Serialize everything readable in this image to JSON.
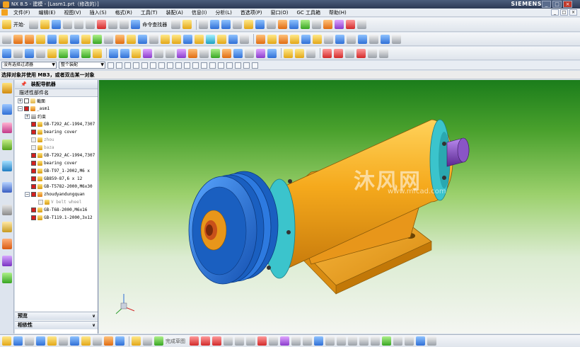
{
  "window": {
    "title": "NX 8.5 - 建模 - [Lasm1.prt（修改的）]",
    "brand": "SIEMENS",
    "controls": [
      "_",
      "□",
      "×"
    ]
  },
  "menubar": {
    "items": [
      "文件(F)",
      "编辑(E)",
      "视图(V)",
      "插入(S)",
      "格式(R)",
      "工具(T)",
      "装配(A)",
      "信息(I)",
      "分析(L)",
      "首选项(P)",
      "窗口(O)",
      "GC 工具箱",
      "帮助(H)"
    ]
  },
  "toolbar1": {
    "start_label": "开始·",
    "command_finder": "命令查找器"
  },
  "selection_bar": {
    "filter_value": "没有选择过滤器",
    "scope_value": "整个装配"
  },
  "cue_line": "选择对象并使用 MB3，或者双击某一对象",
  "navigator": {
    "title": "装配导航器",
    "column_header": "描述性部件名",
    "rows": [
      {
        "label": "截面",
        "level": 0,
        "expand": "+",
        "check": "off",
        "icon": "folder"
      },
      {
        "label": "_asm1",
        "level": 0,
        "expand": "−",
        "check": "on",
        "icon": "asm"
      },
      {
        "label": "约束",
        "level": 1,
        "expand": "+",
        "check": "none",
        "icon": "constraint"
      },
      {
        "label": "GB-T292_AC-1994,7307",
        "level": 1,
        "check": "on",
        "icon": "part"
      },
      {
        "label": "bearing cover",
        "level": 1,
        "check": "on",
        "icon": "part"
      },
      {
        "label": "zhou",
        "level": 1,
        "check": "grey",
        "icon": "part",
        "dim": true
      },
      {
        "label": "baza",
        "level": 1,
        "check": "grey",
        "icon": "part",
        "dim": true
      },
      {
        "label": "GB-T292_AC-1994,7307",
        "level": 1,
        "check": "on",
        "icon": "part"
      },
      {
        "label": "bearing cover",
        "level": 1,
        "check": "on",
        "icon": "part"
      },
      {
        "label": "GB-T97_1-2002,M6 x",
        "level": 1,
        "check": "on",
        "icon": "part"
      },
      {
        "label": "GB859-87,6 x 12",
        "level": 1,
        "check": "on",
        "icon": "part"
      },
      {
        "label": "GB-T5782-2000,M6x30",
        "level": 1,
        "check": "on",
        "icon": "part"
      },
      {
        "label": "zhoudyandungquan",
        "level": 1,
        "expand": "−",
        "check": "on",
        "icon": "asm"
      },
      {
        "label": "V belt wheel",
        "level": 2,
        "check": "grey",
        "icon": "part",
        "dim": true
      },
      {
        "label": "GB-T68-2000,M6x16",
        "level": 1,
        "check": "on",
        "icon": "part"
      },
      {
        "label": "GB-T119.1-2000,3x12",
        "level": 1,
        "check": "on",
        "icon": "part"
      }
    ],
    "sections": [
      "预览",
      "相依性"
    ]
  },
  "viewport": {
    "watermark": "沐风网",
    "watermark_url": "www.mfcad.com",
    "colors": {
      "body": "#f2a31c",
      "pulley": "#1e78d8",
      "flange": "#39c1c9",
      "shaft": "#7b3fb5",
      "background_top": "#1b7d1b",
      "background_bottom": "#f4f6f2"
    }
  },
  "bottom_toolbar": {
    "sketch_done_label": "完成草图"
  }
}
